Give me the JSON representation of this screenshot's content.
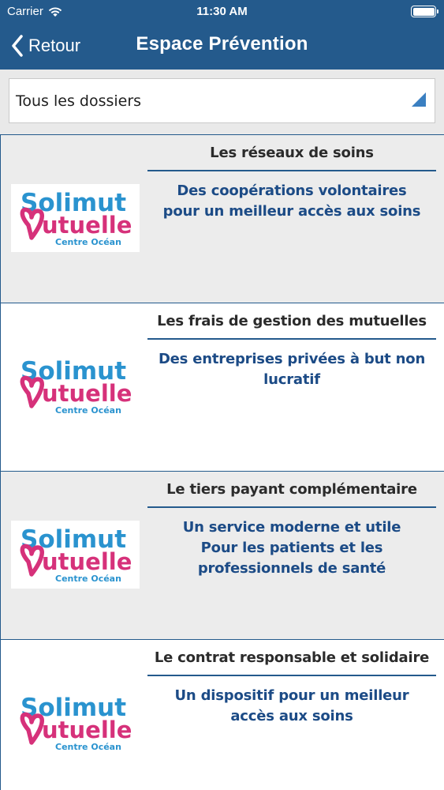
{
  "status_bar": {
    "carrier": "Carrier",
    "time": "11:30 AM"
  },
  "nav": {
    "back_label": "Retour",
    "title": "Espace Prévention"
  },
  "filter": {
    "selected": "Tous les dossiers"
  },
  "logo": {
    "line1": "Solimut",
    "line2": "utuelle",
    "line3": "Centre Océan"
  },
  "articles": [
    {
      "title": "Les réseaux de soins",
      "description": "Des coopérations volontaires\npour un meilleur accès aux soins"
    },
    {
      "title": "Les frais de gestion des mutuelles",
      "description": "Des entreprises privées à but non\nlucratif"
    },
    {
      "title": "Le tiers payant complémentaire",
      "description": "Un service moderne et utile\nPour les patients et les\nprofessionnels de santé"
    },
    {
      "title": "Le contrat responsable et solidaire",
      "description": "Un dispositif pour un meilleur\naccès aux soins"
    }
  ],
  "colors": {
    "nav_background": "#245a8c",
    "accent_text": "#1c4b86",
    "logo_blue": "#2a93cf",
    "logo_pink": "#d6317a"
  },
  "icons": {
    "back": "chevron-left-icon",
    "dropdown": "triangle-corner-icon",
    "wifi": "wifi-icon",
    "battery": "battery-icon"
  }
}
